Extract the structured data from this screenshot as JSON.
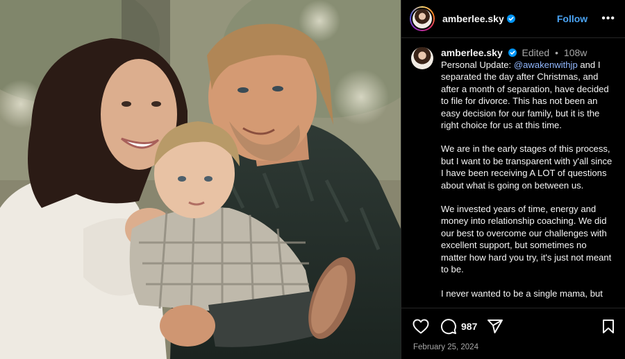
{
  "post": {
    "username": "amberlee.sky",
    "follow_label": "Follow",
    "more_label": "•••",
    "edited_label": "Edited",
    "age": "108w",
    "mention": "@awakenwithjp",
    "caption_prefix": "Personal Update: ",
    "caption_lead_rest": " and I separated the day after Christmas, and after a month of separation, have decided to file for divorce. This has not been an easy decision for our family, but it is the right choice for us at this time.",
    "paragraphs": [
      "We are in the early stages of this process, but I want to be transparent with y'all since I have been receiving A LOT of questions about what is going on between us.",
      "We invested years of time, energy and money into relationship coaching. We did our best to overcome our challenges with excellent support, but sometimes no matter how hard you try, it's just not meant to be.",
      "I never wanted to be a single mama, but"
    ],
    "comment_count": "987",
    "date": "February 25, 2024"
  },
  "icons": {
    "verified": "verified-badge-icon",
    "like": "heart-icon",
    "comment": "comment-bubble-icon",
    "share": "paper-plane-icon",
    "save": "bookmark-icon"
  },
  "colors": {
    "link_blue": "#4aa3f3",
    "mention_blue": "#92b8ff",
    "verified_blue": "#0095f6",
    "muted": "#a8a8a8"
  }
}
